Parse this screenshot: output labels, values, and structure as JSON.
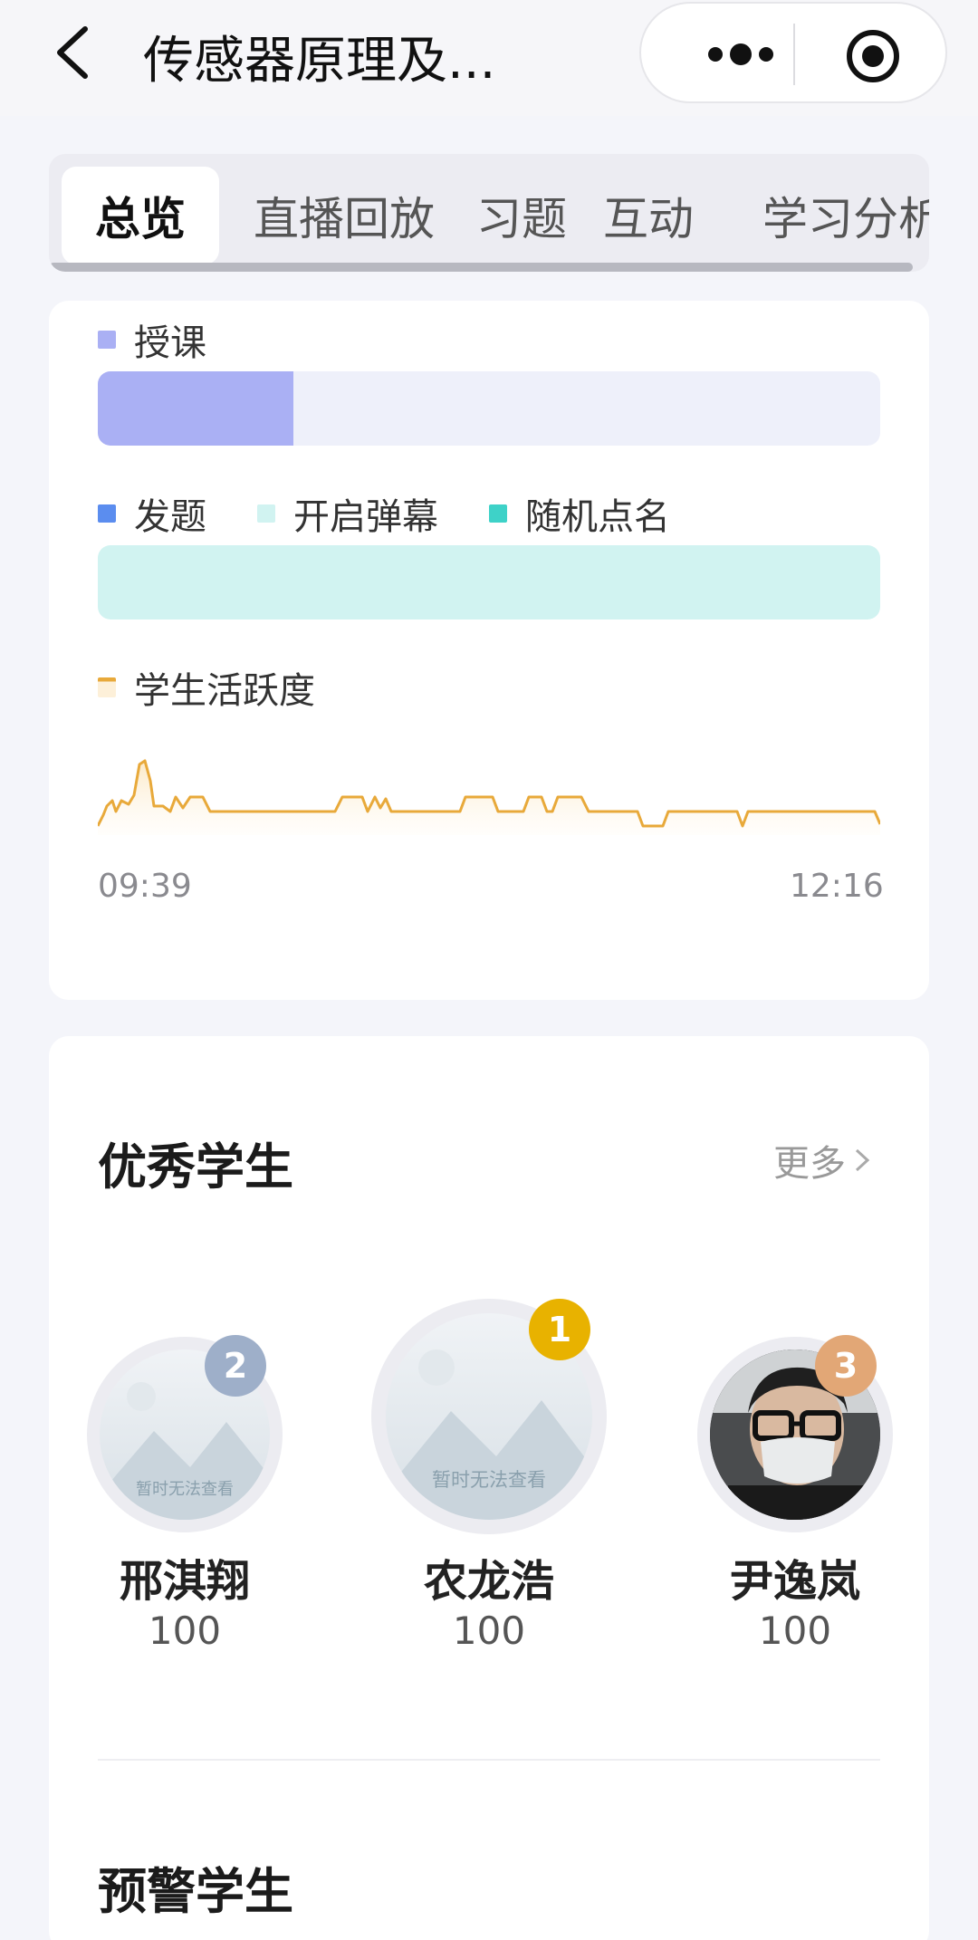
{
  "nav": {
    "title": "传感器原理及...",
    "icons": [
      "back-arrow-icon",
      "more-dots-icon",
      "record-target-icon"
    ]
  },
  "tabs": [
    {
      "label": "总览",
      "active": true
    },
    {
      "label": "直播回放",
      "active": false
    },
    {
      "label": "习题",
      "active": false
    },
    {
      "label": "互动",
      "active": false
    },
    {
      "label": "学习分析",
      "active": false
    }
  ],
  "overview": {
    "teaching_legend": "授课",
    "teaching_progress": 0.25,
    "interaction_legend": {
      "questions": "发题",
      "danmaku": "开启弹幕",
      "rollcall": "随机点名"
    },
    "activity_legend": "学生活跃度",
    "time_start": "09:39",
    "time_end": "12:16",
    "colors": {
      "teaching": "#aab0f4",
      "teaching_track": "#eef0fa",
      "questions": "#5b8def",
      "danmaku": "#d1f3f1",
      "rollcall": "#3ed2c8",
      "activity": "#e8a93a"
    }
  },
  "top_students": {
    "title": "优秀学生",
    "more": "更多",
    "placeholder_text": "暂时无法查看",
    "students": [
      {
        "rank": "2",
        "name": "邢淇翔",
        "score": "100",
        "badge_color": "#9eafc9"
      },
      {
        "rank": "1",
        "name": "农龙浩",
        "score": "100",
        "badge_color": "#e8b200"
      },
      {
        "rank": "3",
        "name": "尹逸岚",
        "score": "100",
        "badge_color": "#e2a776"
      }
    ]
  },
  "warning_students": {
    "title": "预警学生"
  }
}
